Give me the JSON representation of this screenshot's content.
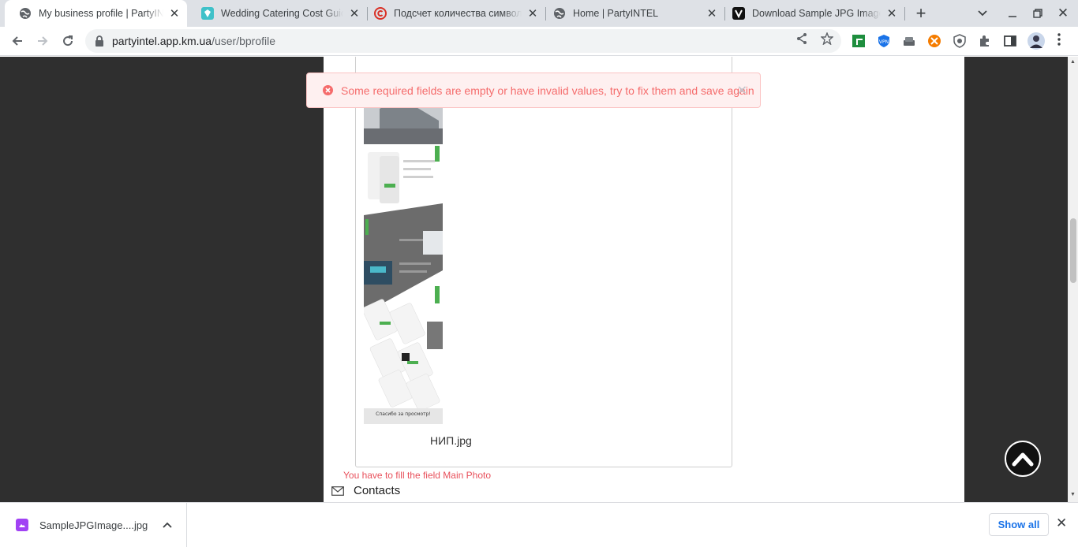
{
  "browser": {
    "tabs": [
      {
        "title": "My business profile | PartyINTEL",
        "active": true,
        "favicon": "globe-icon"
      },
      {
        "title": "Wedding Catering Cost Guide",
        "active": false,
        "favicon": "catering-icon"
      },
      {
        "title": "Подсчет количества символов",
        "active": false,
        "favicon": "copyright-icon"
      },
      {
        "title": "Home | PartyINTEL",
        "active": false,
        "favicon": "globe-icon"
      },
      {
        "title": "Download Sample JPG Image",
        "active": false,
        "favicon": "v-icon"
      }
    ],
    "url_host": "partyintel.app.km.ua",
    "url_path": "/user/bprofile"
  },
  "alert": {
    "message": "Some required fields are empty or have invalid values, try to fix them and save again"
  },
  "photo": {
    "filename": "НИП.jpg",
    "thumb_footer": "Спасибо за просмотр!"
  },
  "form": {
    "error_main_photo": "You have to fill the field Main Photo",
    "contacts_label": "Contacts"
  },
  "downloads": {
    "file": "SampleJPGImage....jpg",
    "show_all": "Show all"
  },
  "colors": {
    "accent": "#1a73e8",
    "error": "#f56c6c",
    "page_bg": "#2f2f2f"
  }
}
